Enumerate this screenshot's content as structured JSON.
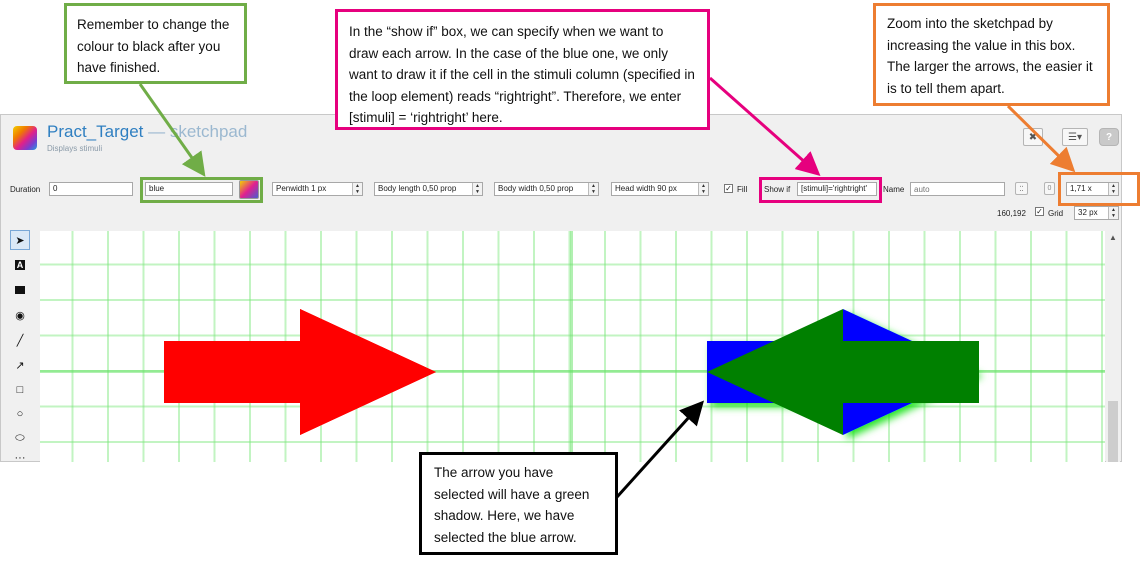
{
  "header": {
    "title": "Pract_Target",
    "separator": " — ",
    "item_type": "sketchpad",
    "subtitle": "Displays stimuli"
  },
  "toolbar": {
    "duration_label": "Duration",
    "duration_value": "0",
    "colour_value": "blue",
    "penwidth": "Penwidth 1 px",
    "body_length": "Body length 0,50 prop",
    "body_width": "Body width 0,50 prop",
    "head_width": "Head width 90 px",
    "fill_label": "Fill",
    "fill_checked": "✓",
    "show_if_label": "Show if",
    "show_if_value": "[stimuli]='rightright'",
    "name_label": "Name",
    "name_placeholder": "auto",
    "zero_label": "0",
    "zoom_value": "1,71 x",
    "coords": "160,192",
    "grid_label": "Grid",
    "grid_checked": "✓",
    "grid_size": "32 px"
  },
  "annotations": {
    "colour_note": "Remember to change the colour to black after you have finished.",
    "show_if_note": "In the “show if” box, we can specify when we want to draw each arrow. In the case of the blue one, we only want to draw it if the cell in the stimuli column (specified in the loop element) reads “rightright”. Therefore, we enter [stimuli] = ‘rightright’ here.",
    "zoom_note": "Zoom into the sketchpad by increasing the value in this box. The larger the arrows, the easier it is to tell them apart.",
    "selection_note": "The arrow you have selected will have a green shadow. Here, we have selected the blue arrow."
  },
  "colors": {
    "green_box": "#70ad47",
    "pink_box": "#e6007e",
    "orange_box": "#ed7d31",
    "arrow_red": "#ff0000",
    "arrow_pink": "#ffc0cb",
    "arrow_blue": "#0000ff",
    "arrow_green": "#008000"
  }
}
